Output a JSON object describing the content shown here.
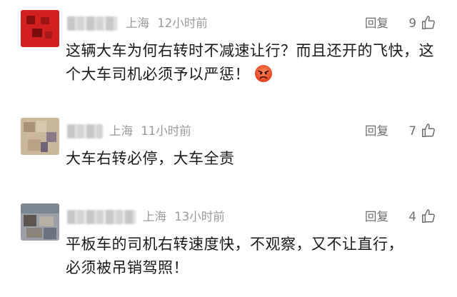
{
  "comments": [
    {
      "location": "上海",
      "time": "12小时前",
      "reply_label": "回复",
      "likes": "9",
      "text": "这辆大车为何右转时不减速让行？而且还开的飞快，这个大车司机必须予以严惩！",
      "emoji": "angry-face-icon"
    },
    {
      "location": "上海",
      "time": "11小时前",
      "reply_label": "回复",
      "likes": "7",
      "text": "大车右转必停，大车全责"
    },
    {
      "location": "上海",
      "time": "13小时前",
      "reply_label": "回复",
      "likes": "4",
      "text": "平板车的司机右转速度快，不观察，又不让直行，必须被吊销驾照！"
    }
  ],
  "colors": {
    "meta_text": "#9a9a9a",
    "reply_text": "#6d6d6d",
    "body_text": "#1a1a1a"
  }
}
